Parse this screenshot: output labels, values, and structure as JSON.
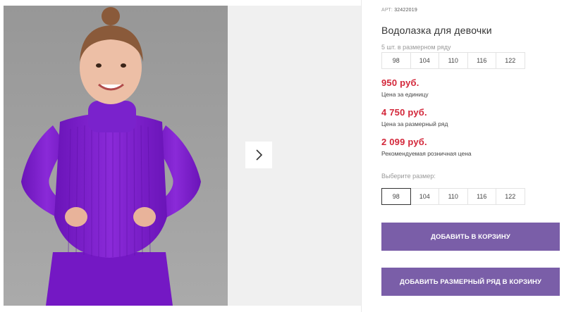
{
  "gallery": {
    "main_photo_alt": "Девочка в фиолетовой водолазке",
    "next_icon": "chevron-right-icon"
  },
  "product": {
    "sku_label": "АРТ:",
    "sku_value": "32422019",
    "title": "Водолазка для девочки",
    "series_caption": "5 шт. в размерном ряду",
    "series_sizes": [
      "98",
      "104",
      "110",
      "116",
      "122"
    ],
    "unit_price": "950 руб.",
    "unit_price_note": "Цена за единицу",
    "series_price": "4 750 руб.",
    "series_price_note": "Цена за размерный ряд",
    "retail_price": "2 099 руб.",
    "retail_price_note": "Рекомендуемая розничная цена",
    "choose_size_caption": "Выберите размер:",
    "choose_sizes": [
      "98",
      "104",
      "110",
      "116",
      "122"
    ],
    "selected_size": "98",
    "add_to_cart_label": "Добавить в корзину",
    "add_series_to_cart_label": "Добавить размерный ряд в корзину"
  },
  "colors": {
    "price": "#d3273a",
    "button": "#7a5ea8",
    "sweater": "#7b1fc8"
  }
}
